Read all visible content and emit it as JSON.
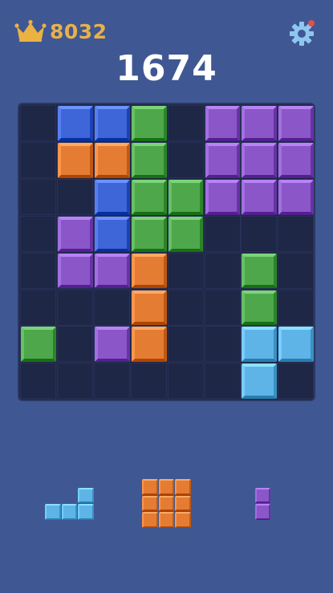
{
  "header": {
    "best_score": "8032",
    "current_score": "1674",
    "crown_icon": "crown-icon",
    "settings_icon": "gear-icon",
    "notification_dot_color": "#e05050"
  },
  "colors": {
    "blue": "#3f66d8",
    "orange": "#e57c34",
    "green": "#4ea84b",
    "purple": "#8a56c8",
    "cyan": "#5eb4e6"
  },
  "board": {
    "rows": 8,
    "cols": 8,
    "cells": [
      [
        null,
        "blue",
        "blue",
        "green",
        null,
        "purple",
        "purple",
        "purple"
      ],
      [
        null,
        "orange",
        "orange",
        "green",
        null,
        "purple",
        "purple",
        "purple"
      ],
      [
        null,
        null,
        "blue",
        "green",
        "green",
        "purple",
        "purple",
        "purple"
      ],
      [
        null,
        "purple",
        "blue",
        "green",
        "green",
        null,
        null,
        null
      ],
      [
        null,
        "purple",
        "purple",
        "orange",
        null,
        null,
        "green",
        null
      ],
      [
        null,
        null,
        null,
        "orange",
        null,
        null,
        "green",
        null
      ],
      [
        "green",
        null,
        "purple",
        "orange",
        null,
        null,
        "cyan",
        "cyan"
      ],
      [
        null,
        null,
        null,
        null,
        null,
        null,
        "cyan",
        null
      ]
    ]
  },
  "tray": {
    "pieces": [
      {
        "name": "l-piece-cyan",
        "color": "cyan",
        "shape": [
          [
            0,
            0,
            1
          ],
          [
            1,
            1,
            1
          ]
        ]
      },
      {
        "name": "square-3x3-orange",
        "color": "orange",
        "shape": [
          [
            1,
            1,
            1
          ],
          [
            1,
            1,
            1
          ],
          [
            1,
            1,
            1
          ]
        ]
      },
      {
        "name": "bar-2-purple",
        "color": "purple",
        "shape": [
          [
            1
          ],
          [
            1
          ]
        ]
      }
    ]
  }
}
